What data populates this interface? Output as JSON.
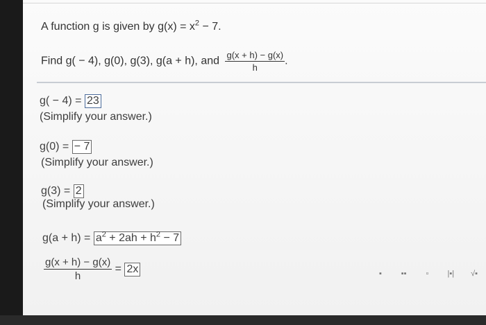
{
  "question": {
    "intro": "A function g is given by g(x) = x",
    "intro_sup": "2",
    "intro_end": " − 7.",
    "find": "Find g( − 4), g(0), g(3), g(a + h), and",
    "frac_num": "g(x + h) − g(x)",
    "frac_den": "h",
    "find_end": "."
  },
  "parts": [
    {
      "label": "g( − 4) =",
      "answer": "23",
      "hint": "(Simplify your answer.)"
    },
    {
      "label": "g(0) =",
      "answer": " − 7",
      "hint": "(Simplify your answer.)"
    },
    {
      "label": "g(3) =",
      "answer": "2",
      "hint": "(Simplify your answer.)"
    }
  ],
  "part4": {
    "label": "g(a + h) =",
    "a": "a",
    "a_sup": "2",
    "mid": " + 2ah + h",
    "h_sup": "2",
    "end": " − 7"
  },
  "part5": {
    "num": "g(x + h) − g(x)",
    "den": "h",
    "eq": "=",
    "answer": "2x"
  },
  "toolbar": {
    "tools": [
      "fraction",
      "mixed-number",
      "exponent",
      "absolute-value",
      "sqrt"
    ],
    "glyphs": [
      "▪",
      "▪▪",
      "▫",
      "|▪|",
      "√▪"
    ]
  }
}
